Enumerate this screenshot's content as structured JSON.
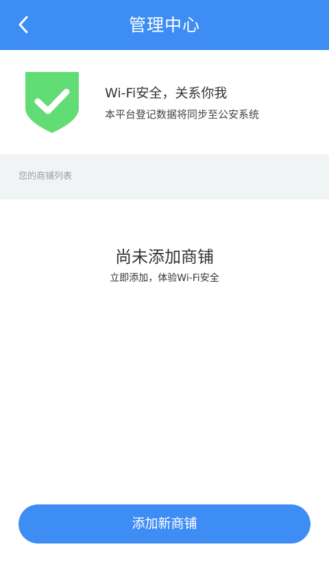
{
  "header": {
    "title": "管理中心",
    "back_icon": "chevron-left-icon",
    "background": "#3d8df5"
  },
  "banner": {
    "icon": "shield-check-icon",
    "icon_color": "#62dc75",
    "title": "Wi-Fi安全，关系你我",
    "subtitle": "本平台登记数据将同步至公安系统"
  },
  "store_list": {
    "section_label": "您的商铺列表",
    "empty_title": "尚未添加商铺",
    "empty_subtitle": "立即添加，体验Wi-Fi安全"
  },
  "footer": {
    "add_button_label": "添加新商铺",
    "accent": "#3d8df5"
  }
}
